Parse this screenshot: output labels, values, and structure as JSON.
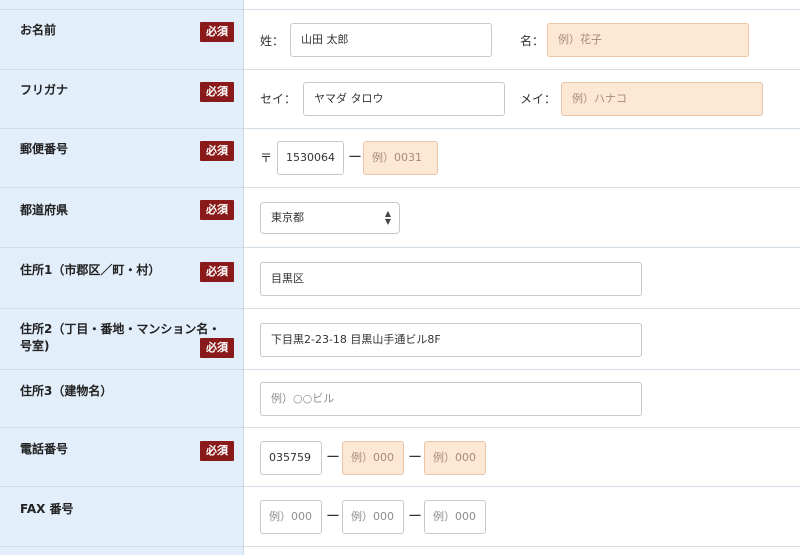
{
  "required_badge": "必須",
  "colors": {
    "label_bg": "#e3eefb",
    "required_bg": "#8a1a1a",
    "placeholder_bg": "#fde8d6"
  },
  "rows": {
    "name": {
      "label": "お名前",
      "sei_label": "姓：",
      "sei_value": "山田 太郎",
      "mei_label": "名：",
      "mei_placeholder": "例）花子"
    },
    "furigana": {
      "label": "フリガナ",
      "sei_label": "セイ：",
      "sei_value": "ヤマダ タロウ",
      "mei_label": "メイ：",
      "mei_placeholder": "例）ハナコ"
    },
    "postal": {
      "label": "郵便番号",
      "mark": "〒",
      "first_value": "1530064",
      "dash": "ー",
      "second_placeholder": "例）0031"
    },
    "prefecture": {
      "label": "都道府県",
      "selected": "東京都"
    },
    "address1": {
      "label": "住所1（市郡区／町・村）",
      "value": "目黒区"
    },
    "address2": {
      "label_line1": "住所2（丁目・番地・マンション名・",
      "label_line2": "号室)",
      "value": "下目黒2-23-18 目黒山手通ビル8F"
    },
    "address3": {
      "label": "住所3（建物名）",
      "placeholder": "例）○○ビル"
    },
    "phone": {
      "label": "電話番号",
      "first_value": "035759",
      "dash": "ー",
      "second_placeholder": "例）000",
      "third_placeholder": "例）000"
    },
    "fax": {
      "label": "FAX 番号",
      "first_placeholder": "例）000",
      "dash": "ー",
      "second_placeholder": "例）000",
      "third_placeholder": "例）000"
    }
  }
}
